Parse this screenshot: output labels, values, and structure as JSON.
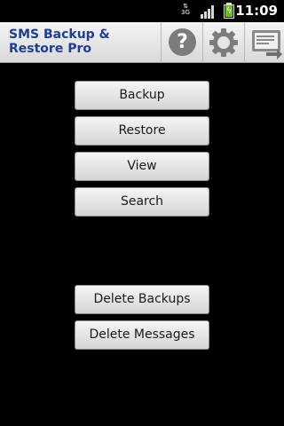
{
  "status_bar": {
    "time": "11:09",
    "network_type": "3G",
    "icons": [
      "data-activity-icon",
      "signal-strength-icon",
      "battery-charging-icon"
    ]
  },
  "title_bar": {
    "title": "SMS Backup & Restore Pro",
    "actions": [
      {
        "name": "help",
        "glyph": "?",
        "icon": "help-icon"
      },
      {
        "name": "settings",
        "icon": "settings-gear-icon"
      },
      {
        "name": "schedule",
        "icon": "scheduled-backup-icon"
      }
    ]
  },
  "main": {
    "buttons": {
      "backup": "Backup",
      "restore": "Restore",
      "view": "View",
      "search": "Search",
      "delete_backups": "Delete Backups",
      "delete_messages": "Delete Messages"
    }
  },
  "colors": {
    "background": "#000000",
    "title_text": "#1c3f94",
    "battery": "#6bbf20"
  }
}
